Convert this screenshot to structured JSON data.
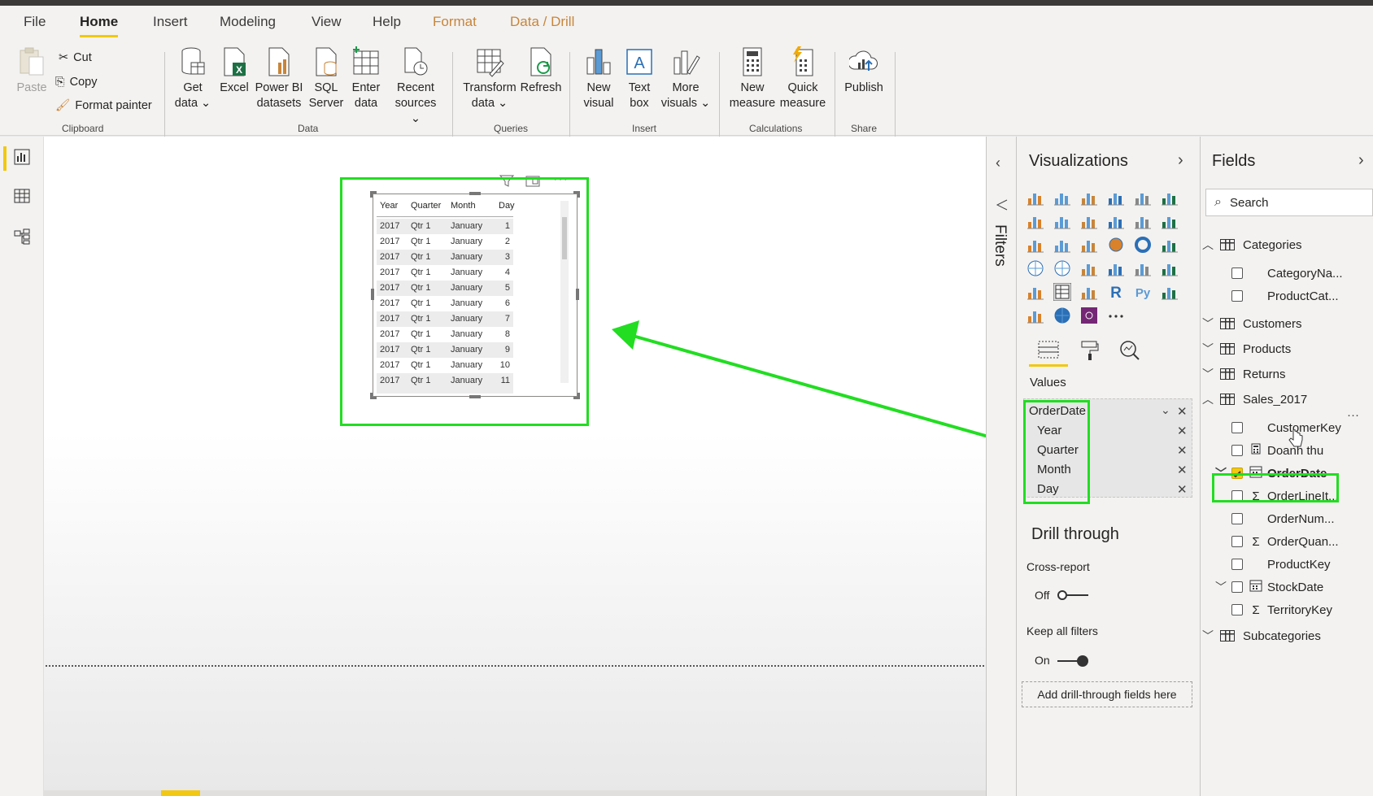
{
  "ribbon": {
    "tabs": [
      "File",
      "Home",
      "Insert",
      "Modeling",
      "View",
      "Help",
      "Format",
      "Data / Drill"
    ],
    "clipboard": {
      "paste": "Paste",
      "cut": "Cut",
      "copy": "Copy",
      "format_painter": "Format painter",
      "group": "Clipboard"
    },
    "data": {
      "get_data": [
        "Get",
        "data"
      ],
      "excel": "Excel",
      "powerbi": [
        "Power BI",
        "datasets"
      ],
      "sql": [
        "SQL",
        "Server"
      ],
      "enter": [
        "Enter",
        "data"
      ],
      "recent": [
        "Recent",
        "sources"
      ],
      "group": "Data"
    },
    "queries": {
      "transform": [
        "Transform",
        "data"
      ],
      "refresh": "Refresh",
      "group": "Queries"
    },
    "insert": {
      "new_visual": [
        "New",
        "visual"
      ],
      "text_box": [
        "Text",
        "box"
      ],
      "more_visuals": [
        "More",
        "visuals"
      ],
      "group": "Insert"
    },
    "calculations": {
      "new_measure": [
        "New",
        "measure"
      ],
      "quick_measure": [
        "Quick",
        "measure"
      ],
      "group": "Calculations"
    },
    "share": {
      "publish": "Publish",
      "group": "Share"
    }
  },
  "visual": {
    "headers": [
      "Year",
      "Quarter",
      "Month",
      "Day"
    ],
    "rows": [
      [
        "2017",
        "Qtr 1",
        "January",
        "1"
      ],
      [
        "2017",
        "Qtr 1",
        "January",
        "2"
      ],
      [
        "2017",
        "Qtr 1",
        "January",
        "3"
      ],
      [
        "2017",
        "Qtr 1",
        "January",
        "4"
      ],
      [
        "2017",
        "Qtr 1",
        "January",
        "5"
      ],
      [
        "2017",
        "Qtr 1",
        "January",
        "6"
      ],
      [
        "2017",
        "Qtr 1",
        "January",
        "7"
      ],
      [
        "2017",
        "Qtr 1",
        "January",
        "8"
      ],
      [
        "2017",
        "Qtr 1",
        "January",
        "9"
      ],
      [
        "2017",
        "Qtr 1",
        "January",
        "10"
      ],
      [
        "2017",
        "Qtr 1",
        "January",
        "11"
      ]
    ]
  },
  "filters": {
    "label": "Filters"
  },
  "visualizations": {
    "title": "Visualizations",
    "values_label": "Values",
    "values_field": "OrderDate",
    "values_items": [
      "Year",
      "Quarter",
      "Month",
      "Day"
    ],
    "drill_title": "Drill through",
    "cross_report": "Cross-report",
    "cross_state": "Off",
    "keep_filters": "Keep all filters",
    "keep_state": "On",
    "add_drill": "Add drill-through fields here",
    "more_glyph": "···"
  },
  "fields": {
    "title": "Fields",
    "search_placeholder": "Search",
    "tables": [
      {
        "name": "Categories",
        "expanded": true
      },
      {
        "name": "Customers",
        "expanded": false
      },
      {
        "name": "Products",
        "expanded": false
      },
      {
        "name": "Returns",
        "expanded": false
      },
      {
        "name": "Sales_2017",
        "expanded": true
      },
      {
        "name": "Subcategories",
        "expanded": false
      }
    ],
    "categories_fields": [
      "CategoryNa...",
      "ProductCat..."
    ],
    "sales_fields": [
      "CustomerKey",
      "Doanh thu",
      "OrderDate",
      "OrderLineIt...",
      "OrderNum...",
      "OrderQuan...",
      "ProductKey",
      "StockDate",
      "TerritoryKey"
    ],
    "more_glyph": "···"
  },
  "colors": {
    "accent_yellow": "#f2c811",
    "highlight_green": "#22dd22"
  }
}
